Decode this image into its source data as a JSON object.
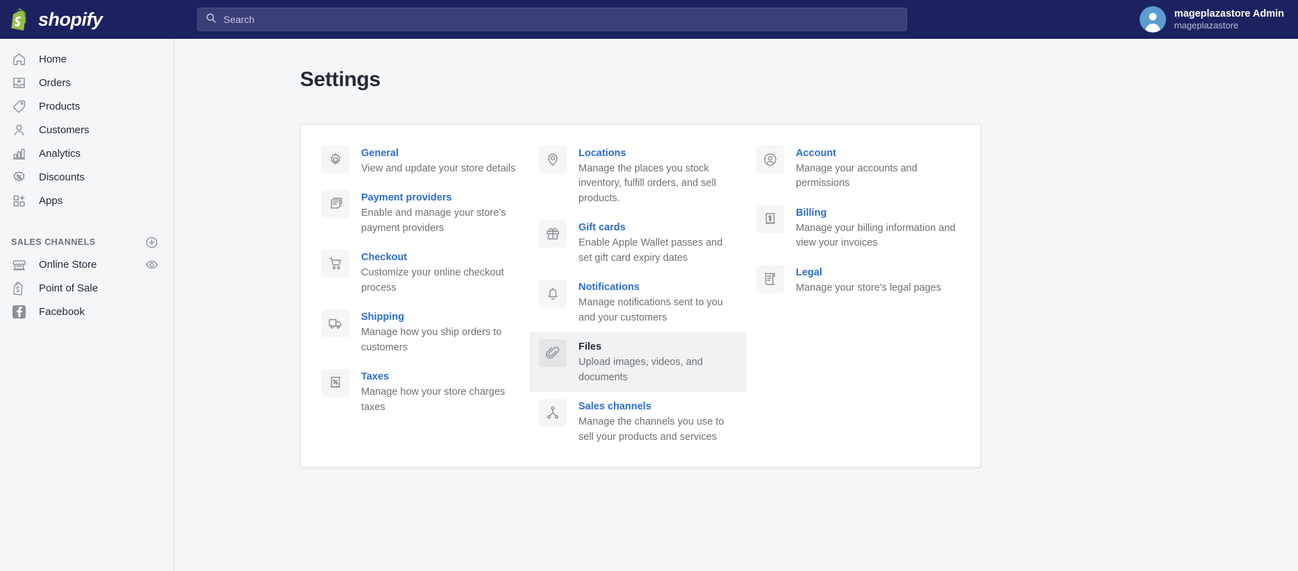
{
  "brand": {
    "name": "shopify",
    "logo_icon": "shopify-bag-icon"
  },
  "search": {
    "placeholder": "Search",
    "icon": "search-icon"
  },
  "user": {
    "name": "mageplazastore Admin",
    "store": "mageplazastore",
    "avatar_icon": "user-avatar-icon"
  },
  "sidebar": {
    "items": [
      {
        "label": "Home",
        "icon": "home-icon"
      },
      {
        "label": "Orders",
        "icon": "orders-inbox-icon"
      },
      {
        "label": "Products",
        "icon": "product-tag-icon"
      },
      {
        "label": "Customers",
        "icon": "person-icon"
      },
      {
        "label": "Analytics",
        "icon": "bar-chart-icon"
      },
      {
        "label": "Discounts",
        "icon": "discount-percent-icon"
      },
      {
        "label": "Apps",
        "icon": "apps-grid-plus-icon"
      }
    ],
    "section": {
      "title": "SALES CHANNELS",
      "action_icon": "plus-circle-icon"
    },
    "channels": [
      {
        "label": "Online Store",
        "icon": "storefront-icon",
        "trailing_icon": "eye-icon"
      },
      {
        "label": "Point of Sale",
        "icon": "shopify-bag-icon",
        "trailing_icon": ""
      },
      {
        "label": "Facebook",
        "icon": "facebook-icon",
        "trailing_icon": ""
      }
    ]
  },
  "main": {
    "title": "Settings",
    "columns": [
      [
        {
          "title": "General",
          "desc": "View and update your store details",
          "icon": "gear-icon",
          "hovered": false
        },
        {
          "title": "Payment providers",
          "desc": "Enable and manage your store's payment providers",
          "icon": "payment-card-icon",
          "hovered": false
        },
        {
          "title": "Checkout",
          "desc": "Customize your online checkout process",
          "icon": "shopping-cart-icon",
          "hovered": false
        },
        {
          "title": "Shipping",
          "desc": "Manage how you ship orders to customers",
          "icon": "truck-icon",
          "hovered": false
        },
        {
          "title": "Taxes",
          "desc": "Manage how your store charges taxes",
          "icon": "receipt-percent-icon",
          "hovered": false
        }
      ],
      [
        {
          "title": "Locations",
          "desc": "Manage the places you stock inventory, fulfill orders, and sell products.",
          "icon": "map-pin-icon",
          "hovered": false
        },
        {
          "title": "Gift cards",
          "desc": "Enable Apple Wallet passes and set gift card expiry dates",
          "icon": "gift-icon",
          "hovered": false
        },
        {
          "title": "Notifications",
          "desc": "Manage notifications sent to you and your customers",
          "icon": "bell-icon",
          "hovered": false
        },
        {
          "title": "Files",
          "desc": "Upload images, videos, and documents",
          "icon": "paperclip-icon",
          "hovered": true
        },
        {
          "title": "Sales channels",
          "desc": "Manage the channels you use to sell your products and services",
          "icon": "network-nodes-icon",
          "hovered": false
        }
      ],
      [
        {
          "title": "Account",
          "desc": "Manage your accounts and permissions",
          "icon": "account-circle-icon",
          "hovered": false
        },
        {
          "title": "Billing",
          "desc": "Manage your billing information and view your invoices",
          "icon": "receipt-dollar-icon",
          "hovered": false
        },
        {
          "title": "Legal",
          "desc": "Manage your store's legal pages",
          "icon": "legal-scroll-icon",
          "hovered": false
        }
      ]
    ]
  },
  "colors": {
    "header": "#1c2260",
    "link": "#2c6ecb",
    "text": "#212b36",
    "muted": "#6d7175",
    "sidebar": "#f4f6f8"
  }
}
